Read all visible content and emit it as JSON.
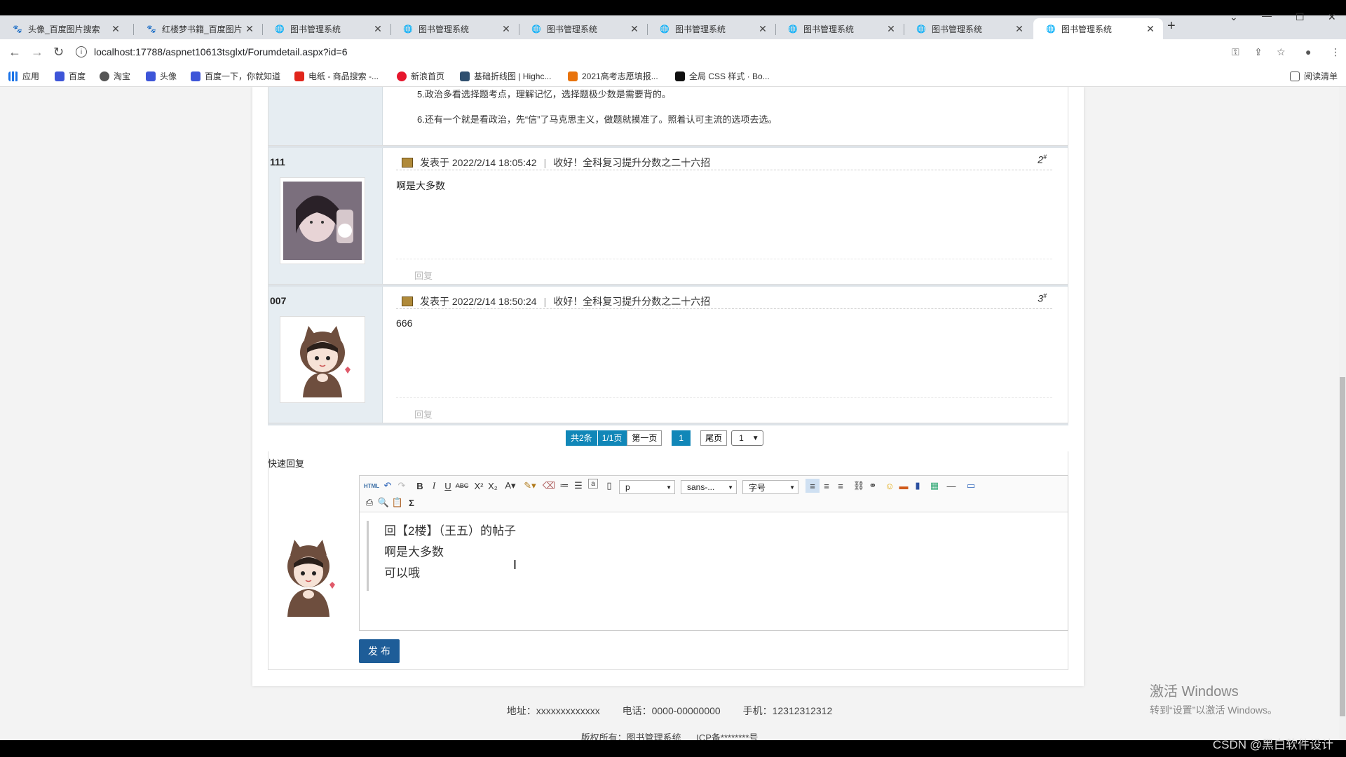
{
  "browser": {
    "tabs": [
      {
        "title": "头像_百度图片搜索",
        "icon": "paw-icon",
        "active": false
      },
      {
        "title": "红楼梦书籍_百度图片",
        "icon": "paw-icon",
        "active": false
      },
      {
        "title": "图书管理系统",
        "icon": "globe-icon",
        "active": false
      },
      {
        "title": "图书管理系统",
        "icon": "globe-icon",
        "active": false
      },
      {
        "title": "图书管理系统",
        "icon": "globe-icon",
        "active": false
      },
      {
        "title": "图书管理系统",
        "icon": "globe-icon",
        "active": false
      },
      {
        "title": "图书管理系统",
        "icon": "globe-icon",
        "active": false
      },
      {
        "title": "图书管理系统",
        "icon": "globe-icon",
        "active": false
      },
      {
        "title": "图书管理系统",
        "icon": "globe-icon",
        "active": true
      }
    ],
    "url": "localhost:17788/aspnet10613tsglxt/Forumdetail.aspx?id=6",
    "bookmarks": [
      {
        "label": "应用",
        "icon": "apps-icon"
      },
      {
        "label": "百度",
        "icon": "paw-icon"
      },
      {
        "label": "淘宝",
        "icon": "globe-icon"
      },
      {
        "label": "头像",
        "icon": "paw-icon"
      },
      {
        "label": "百度一下，你就知道",
        "icon": "paw-icon"
      },
      {
        "label": "电纸 - 商品搜索 -...",
        "icon": "jd-icon"
      },
      {
        "label": "新浪首页",
        "icon": "sina-icon"
      },
      {
        "label": "基础折线图 | Highc...",
        "icon": "highcharts-icon"
      },
      {
        "label": "2021高考志愿填报...",
        "icon": "gaokao-icon"
      },
      {
        "label": "全局 CSS 样式 · Bo...",
        "icon": "bootstrap-icon"
      }
    ],
    "reading_list": "阅读清单"
  },
  "forum": {
    "top_post_text": "5.政治多看选择题考点，理解记忆，选择题极少数是需要背的。",
    "top_post_text2": "6.还有一个就是看政治，先“信”了马克思主义，做题就摸准了。照着认可主流的选项去选。",
    "posts": [
      {
        "username": "111",
        "posted_label": "发表于",
        "time": "2022/2/14 18:05:42",
        "topic": "收好！全科复习提升分数之二十六招",
        "floor": "2",
        "floor_mark": "#",
        "content": "啊是大多数",
        "reply": "回复"
      },
      {
        "username": "007",
        "posted_label": "发表于",
        "time": "2022/2/14 18:50:24",
        "topic": "收好！全科复习提升分数之二十六招",
        "floor": "3",
        "floor_mark": "#",
        "content": "666",
        "reply": "回复"
      }
    ],
    "pager": {
      "total": "共2条",
      "pages": "1/1页",
      "first": "第一页",
      "current": "1",
      "last": "尾页",
      "select": "1"
    },
    "quick_reply_label": "快速回复",
    "editor": {
      "html_btn": "HTML",
      "paragraph": "p",
      "font": "sans-...",
      "size": "字号",
      "lines": [
        "回【2楼】（王五）的帖子",
        "啊是大多数",
        "可以哦"
      ]
    },
    "submit_label": "发 布"
  },
  "footer": {
    "address": "地址：xxxxxxxxxxxxx",
    "phone": "电话：0000-00000000",
    "mobile": "手机：12312312312",
    "copyright": "版权所有：图书管理系统",
    "icp": "ICP备********号"
  },
  "watermark": {
    "line1": "激活 Windows",
    "line2": "转到“设置”以激活 Windows。"
  },
  "csdn": "CSDN @黑白软件设计"
}
